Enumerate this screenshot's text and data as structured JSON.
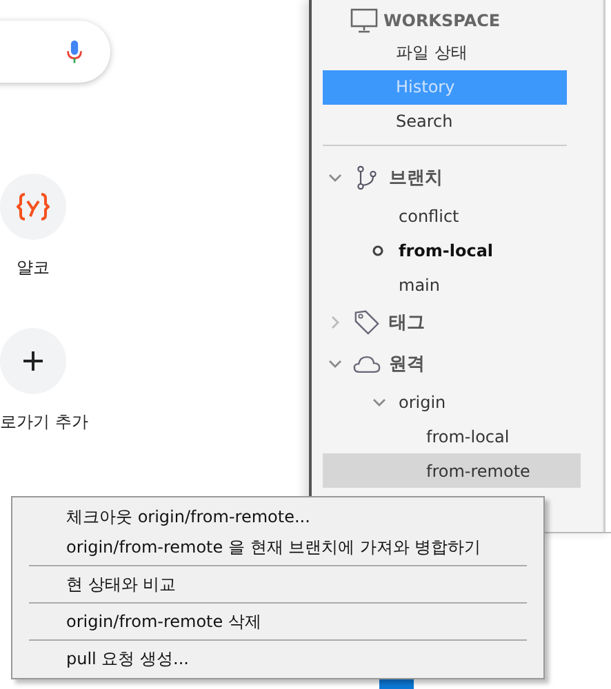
{
  "browser": {
    "shortcuts": [
      {
        "kind": "site",
        "label": "얄코"
      },
      {
        "kind": "add",
        "label": "로가기 추가"
      }
    ]
  },
  "sidebar": {
    "workspace": {
      "title": "WORKSPACE",
      "items": [
        {
          "label": "파일 상태",
          "selected": false
        },
        {
          "label": "History",
          "selected": true
        },
        {
          "label": "Search",
          "selected": false
        }
      ]
    },
    "sections": [
      {
        "kind": "branch",
        "title": "브랜치",
        "expanded": true,
        "items": [
          {
            "label": "conflict",
            "current": false,
            "selected": false
          },
          {
            "label": "from-local",
            "current": true,
            "selected": false
          },
          {
            "label": "main",
            "current": false,
            "selected": false
          }
        ]
      },
      {
        "kind": "tag",
        "title": "태그",
        "expanded": false
      },
      {
        "kind": "remote",
        "title": "원격",
        "expanded": true,
        "items": [
          {
            "label": "origin",
            "current": false,
            "selected": false,
            "expanded": true,
            "children": [
              {
                "label": "from-local",
                "current": false,
                "selected": false
              },
              {
                "label": "from-remote",
                "current": false,
                "selected": true
              }
            ]
          }
        ]
      }
    ]
  },
  "context_menu": {
    "groups": [
      [
        "체크아웃 origin/from-remote...",
        "origin/from-remote 을 현재 브랜치에 가져와 병합하기"
      ],
      [
        "현 상태와 비교"
      ],
      [
        "origin/from-remote 삭제"
      ],
      [
        "pull 요청 생성..."
      ]
    ]
  }
}
